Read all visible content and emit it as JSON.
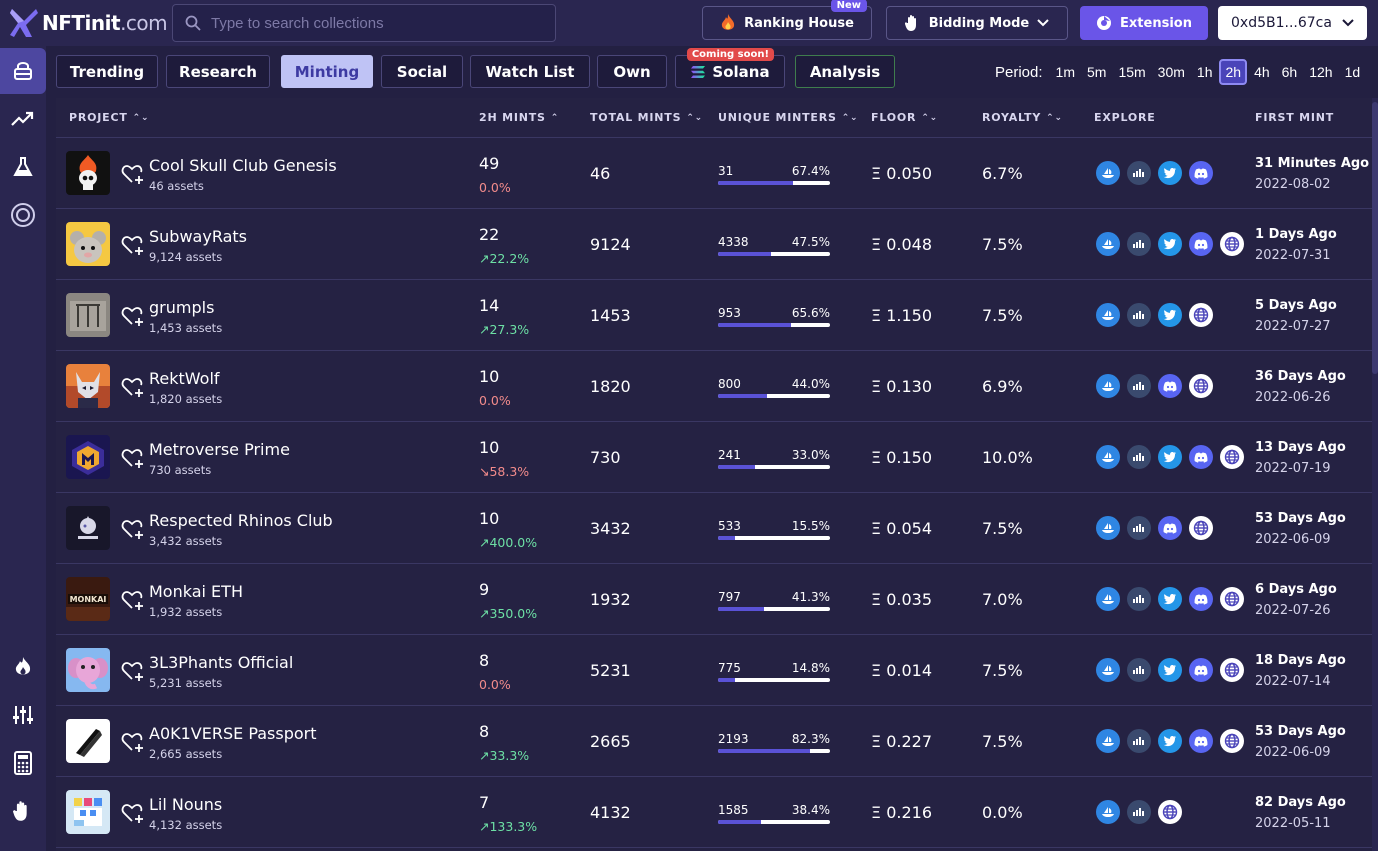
{
  "app": {
    "logo_text": "NFTinit",
    "logo_domain": ".com"
  },
  "search": {
    "placeholder": "Type to search collections"
  },
  "topbar": {
    "ranking_label": "Ranking House",
    "ranking_badge": "New",
    "bidding_label": "Bidding Mode",
    "extension_label": "Extension",
    "wallet_label": "0xd5B1...67ca"
  },
  "tabs": [
    {
      "label": "Trending"
    },
    {
      "label": "Research"
    },
    {
      "label": "Minting"
    },
    {
      "label": "Social"
    },
    {
      "label": "Watch List"
    },
    {
      "label": "Own"
    },
    {
      "label": "Solana",
      "badge": "Coming soon!"
    },
    {
      "label": "Analysis"
    }
  ],
  "period": {
    "label": "Period:",
    "options": [
      "1m",
      "5m",
      "15m",
      "30m",
      "1h",
      "2h",
      "4h",
      "6h",
      "12h",
      "1d"
    ],
    "selected": "2h"
  },
  "table": {
    "headers": {
      "project": "PROJECT",
      "mints2h": "2H MINTS",
      "total": "TOTAL MINTS",
      "unique": "UNIQUE MINTERS",
      "floor": "FLOOR",
      "royalty": "ROYALTY",
      "explore": "EXPLORE",
      "first": "FIRST MINT"
    },
    "rows": [
      {
        "name": "Cool Skull Club Genesis",
        "assets": "46 assets",
        "mints": "49",
        "change": "0.0%",
        "change_dir": "zero",
        "total": "46",
        "unique_count": "31",
        "unique_pct": "67.4%",
        "unique_fill": 0.674,
        "floor": "Ξ 0.050",
        "royalty": "6.7%",
        "explore": [
          "opensea-icon",
          "looksrare-icon",
          "twitter-icon",
          "discord-icon"
        ],
        "first_ago": "31 Minutes Ago",
        "first_date": "2022-08-02",
        "thumb": "skull"
      },
      {
        "name": "SubwayRats",
        "assets": "9,124 assets",
        "mints": "22",
        "change": "↗22.2%",
        "change_dir": "up",
        "total": "9124",
        "unique_count": "4338",
        "unique_pct": "47.5%",
        "unique_fill": 0.475,
        "floor": "Ξ 0.048",
        "royalty": "7.5%",
        "explore": [
          "opensea-icon",
          "looksrare-icon",
          "twitter-icon",
          "discord-icon",
          "website-icon"
        ],
        "first_ago": "1 Days Ago",
        "first_date": "2022-07-31",
        "thumb": "rat"
      },
      {
        "name": "grumpls",
        "assets": "1,453 assets",
        "mints": "14",
        "change": "↗27.3%",
        "change_dir": "up",
        "total": "1453",
        "unique_count": "953",
        "unique_pct": "65.6%",
        "unique_fill": 0.656,
        "floor": "Ξ 1.150",
        "royalty": "7.5%",
        "explore": [
          "opensea-icon",
          "looksrare-icon",
          "twitter-icon",
          "website-icon"
        ],
        "first_ago": "5 Days Ago",
        "first_date": "2022-07-27",
        "thumb": "grumpls"
      },
      {
        "name": "RektWolf",
        "assets": "1,820 assets",
        "mints": "10",
        "change": "0.0%",
        "change_dir": "zero",
        "total": "1820",
        "unique_count": "800",
        "unique_pct": "44.0%",
        "unique_fill": 0.44,
        "floor": "Ξ 0.130",
        "royalty": "6.9%",
        "explore": [
          "opensea-icon",
          "looksrare-icon",
          "discord-icon",
          "website-icon"
        ],
        "first_ago": "36 Days Ago",
        "first_date": "2022-06-26",
        "thumb": "wolf"
      },
      {
        "name": "Metroverse Prime",
        "assets": "730 assets",
        "mints": "10",
        "change": "↘58.3%",
        "change_dir": "down",
        "total": "730",
        "unique_count": "241",
        "unique_pct": "33.0%",
        "unique_fill": 0.33,
        "floor": "Ξ 0.150",
        "royalty": "10.0%",
        "explore": [
          "opensea-icon",
          "looksrare-icon",
          "twitter-icon",
          "discord-icon",
          "website-icon"
        ],
        "first_ago": "13 Days Ago",
        "first_date": "2022-07-19",
        "thumb": "metro"
      },
      {
        "name": "Respected Rhinos Club",
        "assets": "3,432 assets",
        "mints": "10",
        "change": "↗400.0%",
        "change_dir": "up",
        "total": "3432",
        "unique_count": "533",
        "unique_pct": "15.5%",
        "unique_fill": 0.155,
        "floor": "Ξ 0.054",
        "royalty": "7.5%",
        "explore": [
          "opensea-icon",
          "looksrare-icon",
          "discord-icon",
          "website-icon"
        ],
        "first_ago": "53 Days Ago",
        "first_date": "2022-06-09",
        "thumb": "rhino"
      },
      {
        "name": "Monkai ETH",
        "assets": "1,932 assets",
        "mints": "9",
        "change": "↗350.0%",
        "change_dir": "up",
        "total": "1932",
        "unique_count": "797",
        "unique_pct": "41.3%",
        "unique_fill": 0.413,
        "floor": "Ξ 0.035",
        "royalty": "7.0%",
        "explore": [
          "opensea-icon",
          "looksrare-icon",
          "twitter-icon",
          "discord-icon",
          "website-icon"
        ],
        "first_ago": "6 Days Ago",
        "first_date": "2022-07-26",
        "thumb": "monkai",
        "thumb_text": "MONKAI"
      },
      {
        "name": "3L3Phants Official",
        "assets": "5,231 assets",
        "mints": "8",
        "change": "0.0%",
        "change_dir": "zero",
        "total": "5231",
        "unique_count": "775",
        "unique_pct": "14.8%",
        "unique_fill": 0.148,
        "floor": "Ξ 0.014",
        "royalty": "7.5%",
        "explore": [
          "opensea-icon",
          "looksrare-icon",
          "twitter-icon",
          "discord-icon",
          "website-icon"
        ],
        "first_ago": "18 Days Ago",
        "first_date": "2022-07-14",
        "thumb": "elephant"
      },
      {
        "name": "A0K1VERSE Passport",
        "assets": "2,665 assets",
        "mints": "8",
        "change": "↗33.3%",
        "change_dir": "up",
        "total": "2665",
        "unique_count": "2193",
        "unique_pct": "82.3%",
        "unique_fill": 0.823,
        "floor": "Ξ 0.227",
        "royalty": "7.5%",
        "explore": [
          "opensea-icon",
          "looksrare-icon",
          "twitter-icon",
          "discord-icon",
          "website-icon"
        ],
        "first_ago": "53 Days Ago",
        "first_date": "2022-06-09",
        "thumb": "aoki"
      },
      {
        "name": "Lil Nouns",
        "assets": "4,132 assets",
        "mints": "7",
        "change": "↗133.3%",
        "change_dir": "up",
        "total": "4132",
        "unique_count": "1585",
        "unique_pct": "38.4%",
        "unique_fill": 0.384,
        "floor": "Ξ 0.216",
        "royalty": "0.0%",
        "explore": [
          "opensea-icon",
          "looksrare-icon",
          "website-icon"
        ],
        "first_ago": "82 Days Ago",
        "first_date": "2022-05-11",
        "thumb": "nouns"
      }
    ]
  }
}
